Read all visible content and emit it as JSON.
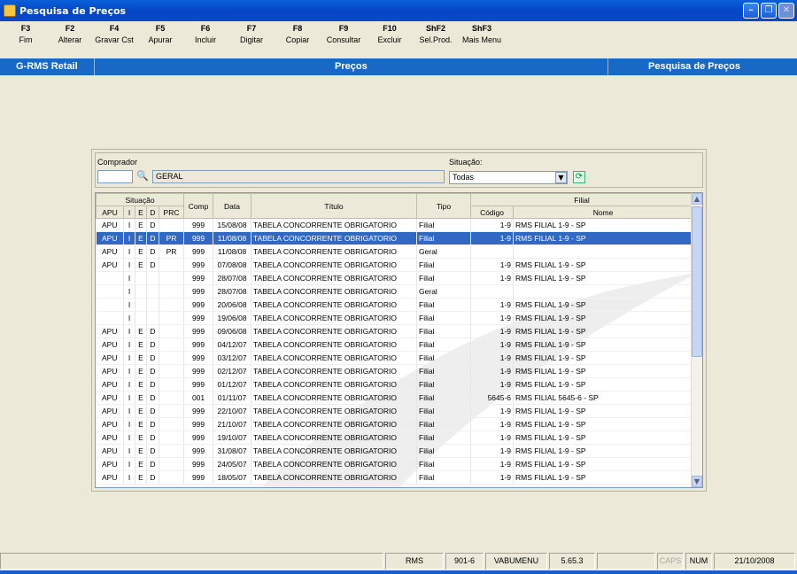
{
  "window": {
    "title": "Pesquisa de Preços"
  },
  "toolbar": [
    {
      "key": "F3",
      "label": "Fim"
    },
    {
      "key": "F2",
      "label": "Alterar"
    },
    {
      "key": "F4",
      "label": "Gravar Cst"
    },
    {
      "key": "F5",
      "label": "Apurar"
    },
    {
      "key": "F6",
      "label": "Incluir"
    },
    {
      "key": "F7",
      "label": "Digitar"
    },
    {
      "key": "F8",
      "label": "Copiar"
    },
    {
      "key": "F9",
      "label": "Consultar"
    },
    {
      "key": "F10",
      "label": "Excluir"
    },
    {
      "key": "ShF2",
      "label": "Sel.Prod."
    },
    {
      "key": "ShF3",
      "label": "Mais Menu"
    }
  ],
  "header": {
    "left": "G-RMS Retail",
    "center": "Preços",
    "right": "Pesquisa de Preços"
  },
  "filters": {
    "comprador_label": "Comprador",
    "comprador_code": "",
    "comprador_name": "GERAL",
    "situacao_label": "Situação:",
    "situacao_value": "Todas"
  },
  "grid": {
    "headers": {
      "situacao": "Situação",
      "apu": "APU",
      "i": "I",
      "e": "E",
      "d": "D",
      "prc": "PRC",
      "comp": "Comp",
      "data": "Data",
      "titulo": "Título",
      "tipo": "Tipo",
      "filial": "Filial",
      "codigo": "Código",
      "nome": "Nome"
    },
    "rows": [
      {
        "apu": "APU",
        "i": "I",
        "e": "E",
        "d": "D",
        "prc": "",
        "comp": "999",
        "data": "15/08/08",
        "titulo": "TABELA CONCORRENTE OBRIGATORIO",
        "tipo": "Filial",
        "codigo": "1-9",
        "nome": "RMS FILIAL 1-9 - SP",
        "selected": false
      },
      {
        "apu": "APU",
        "i": "I",
        "e": "E",
        "d": "D",
        "prc": "PR",
        "comp": "999",
        "data": "11/08/08",
        "titulo": "TABELA CONCORRENTE OBRIGATORIO",
        "tipo": "Filial",
        "codigo": "1-9",
        "nome": "RMS FILIAL 1-9 - SP",
        "selected": true
      },
      {
        "apu": "APU",
        "i": "I",
        "e": "E",
        "d": "D",
        "prc": "PR",
        "comp": "999",
        "data": "11/08/08",
        "titulo": "TABELA CONCORRENTE OBRIGATORIO",
        "tipo": "Geral",
        "codigo": "",
        "nome": "",
        "selected": false
      },
      {
        "apu": "APU",
        "i": "I",
        "e": "E",
        "d": "D",
        "prc": "",
        "comp": "999",
        "data": "07/08/08",
        "titulo": "TABELA CONCORRENTE OBRIGATORIO",
        "tipo": "Filial",
        "codigo": "1-9",
        "nome": "RMS FILIAL 1-9 - SP",
        "selected": false
      },
      {
        "apu": "",
        "i": "I",
        "e": "",
        "d": "",
        "prc": "",
        "comp": "999",
        "data": "28/07/08",
        "titulo": "TABELA CONCORRENTE OBRIGATORIO",
        "tipo": "Filial",
        "codigo": "1-9",
        "nome": "RMS FILIAL 1-9 - SP",
        "selected": false
      },
      {
        "apu": "",
        "i": "I",
        "e": "",
        "d": "",
        "prc": "",
        "comp": "999",
        "data": "28/07/08",
        "titulo": "TABELA CONCORRENTE OBRIGATORIO",
        "tipo": "Geral",
        "codigo": "",
        "nome": "",
        "selected": false
      },
      {
        "apu": "",
        "i": "I",
        "e": "",
        "d": "",
        "prc": "",
        "comp": "999",
        "data": "20/06/08",
        "titulo": "TABELA CONCORRENTE OBRIGATORIO",
        "tipo": "Filial",
        "codigo": "1-9",
        "nome": "RMS FILIAL 1-9 - SP",
        "selected": false
      },
      {
        "apu": "",
        "i": "I",
        "e": "",
        "d": "",
        "prc": "",
        "comp": "999",
        "data": "19/06/08",
        "titulo": "TABELA CONCORRENTE OBRIGATORIO",
        "tipo": "Filial",
        "codigo": "1-9",
        "nome": "RMS FILIAL 1-9 - SP",
        "selected": false
      },
      {
        "apu": "APU",
        "i": "I",
        "e": "E",
        "d": "D",
        "prc": "",
        "comp": "999",
        "data": "09/06/08",
        "titulo": "TABELA CONCORRENTE OBRIGATORIO",
        "tipo": "Filial",
        "codigo": "1-9",
        "nome": "RMS FILIAL 1-9 - SP",
        "selected": false
      },
      {
        "apu": "APU",
        "i": "I",
        "e": "E",
        "d": "D",
        "prc": "",
        "comp": "999",
        "data": "04/12/07",
        "titulo": "TABELA CONCORRENTE OBRIGATORIO",
        "tipo": "Filial",
        "codigo": "1-9",
        "nome": "RMS FILIAL 1-9 - SP",
        "selected": false
      },
      {
        "apu": "APU",
        "i": "I",
        "e": "E",
        "d": "D",
        "prc": "",
        "comp": "999",
        "data": "03/12/07",
        "titulo": "TABELA CONCORRENTE OBRIGATORIO",
        "tipo": "Filial",
        "codigo": "1-9",
        "nome": "RMS FILIAL 1-9 - SP",
        "selected": false
      },
      {
        "apu": "APU",
        "i": "I",
        "e": "E",
        "d": "D",
        "prc": "",
        "comp": "999",
        "data": "02/12/07",
        "titulo": "TABELA CONCORRENTE OBRIGATORIO",
        "tipo": "Filial",
        "codigo": "1-9",
        "nome": "RMS FILIAL 1-9 - SP",
        "selected": false
      },
      {
        "apu": "APU",
        "i": "I",
        "e": "E",
        "d": "D",
        "prc": "",
        "comp": "999",
        "data": "01/12/07",
        "titulo": "TABELA CONCORRENTE OBRIGATORIO",
        "tipo": "Filial",
        "codigo": "1-9",
        "nome": "RMS FILIAL 1-9 - SP",
        "selected": false
      },
      {
        "apu": "APU",
        "i": "I",
        "e": "E",
        "d": "D",
        "prc": "",
        "comp": "001",
        "data": "01/11/07",
        "titulo": "TABELA CONCORRENTE OBRIGATORIO",
        "tipo": "Filial",
        "codigo": "5645-6",
        "nome": "RMS FILIAL 5645-6 - SP",
        "selected": false
      },
      {
        "apu": "APU",
        "i": "I",
        "e": "E",
        "d": "D",
        "prc": "",
        "comp": "999",
        "data": "22/10/07",
        "titulo": "TABELA CONCORRENTE OBRIGATORIO",
        "tipo": "Filial",
        "codigo": "1-9",
        "nome": "RMS FILIAL 1-9 - SP",
        "selected": false
      },
      {
        "apu": "APU",
        "i": "I",
        "e": "E",
        "d": "D",
        "prc": "",
        "comp": "999",
        "data": "21/10/07",
        "titulo": "TABELA CONCORRENTE OBRIGATORIO",
        "tipo": "Filial",
        "codigo": "1-9",
        "nome": "RMS FILIAL 1-9 - SP",
        "selected": false
      },
      {
        "apu": "APU",
        "i": "I",
        "e": "E",
        "d": "D",
        "prc": "",
        "comp": "999",
        "data": "19/10/07",
        "titulo": "TABELA CONCORRENTE OBRIGATORIO",
        "tipo": "Filial",
        "codigo": "1-9",
        "nome": "RMS FILIAL 1-9 - SP",
        "selected": false
      },
      {
        "apu": "APU",
        "i": "I",
        "e": "E",
        "d": "D",
        "prc": "",
        "comp": "999",
        "data": "31/08/07",
        "titulo": "TABELA CONCORRENTE OBRIGATORIO",
        "tipo": "Filial",
        "codigo": "1-9",
        "nome": "RMS FILIAL 1-9 - SP",
        "selected": false
      },
      {
        "apu": "APU",
        "i": "I",
        "e": "E",
        "d": "D",
        "prc": "",
        "comp": "999",
        "data": "24/05/07",
        "titulo": "TABELA CONCORRENTE OBRIGATORIO",
        "tipo": "Filial",
        "codigo": "1-9",
        "nome": "RMS FILIAL 1-9 - SP",
        "selected": false
      },
      {
        "apu": "APU",
        "i": "I",
        "e": "E",
        "d": "D",
        "prc": "",
        "comp": "999",
        "data": "18/05/07",
        "titulo": "TABELA CONCORRENTE OBRIGATORIO",
        "tipo": "Filial",
        "codigo": "1-9",
        "nome": "RMS FILIAL 1-9 - SP",
        "selected": false
      }
    ]
  },
  "statusbar": {
    "s1": "RMS",
    "s2": "901-6",
    "s3": "VABUMENU",
    "s4": "5.65.3",
    "caps": "CAPS",
    "num": "NUM",
    "date": "21/10/2008"
  },
  "colors": {
    "header_blue": "#1868c8",
    "selection": "#3168c6",
    "titlebar": "#0546c6"
  },
  "icons": {
    "binoculars": "binoculars-icon",
    "dropdown": "chevron-down-icon",
    "refresh": "refresh-icon",
    "scroll_up": "scroll-up-icon",
    "scroll_down": "scroll-down-icon"
  }
}
